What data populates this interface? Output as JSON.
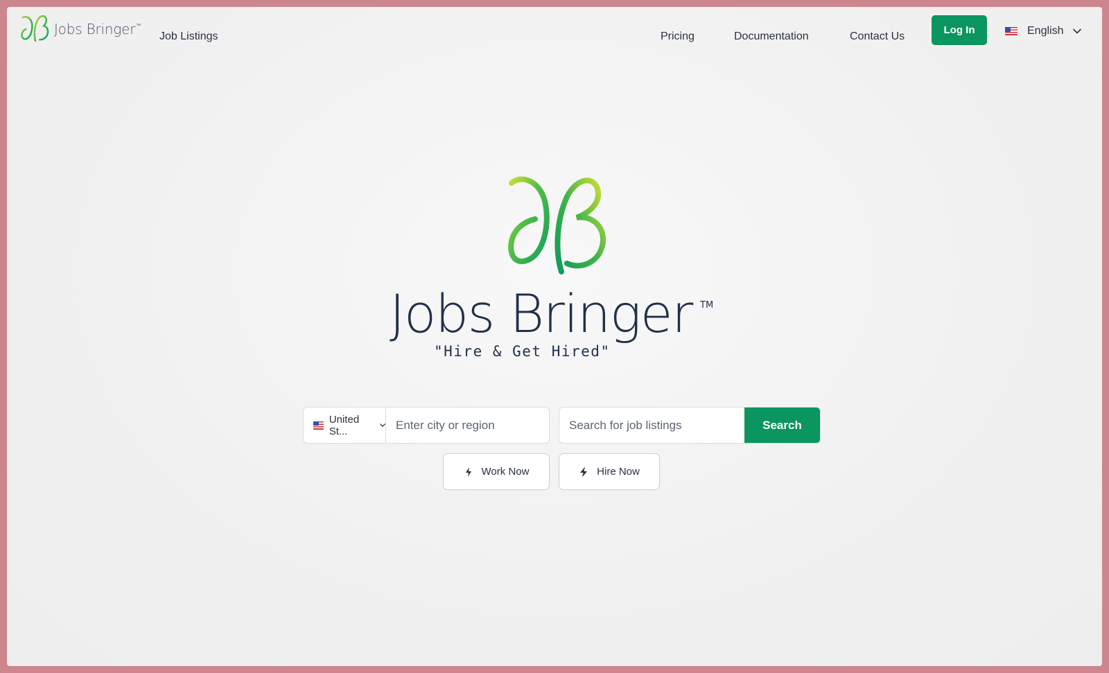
{
  "brand": {
    "name": "Jobs Bringer",
    "tm": "™"
  },
  "nav": {
    "job_listings": "Job Listings",
    "pricing": "Pricing",
    "documentation": "Documentation",
    "contact": "Contact Us",
    "login": "Log In",
    "language": "English"
  },
  "hero": {
    "title": "Jobs Bringer",
    "tm": "TM",
    "tagline": "\"Hire & Get Hired\""
  },
  "search": {
    "country": "United St...",
    "city_placeholder": "Enter city or region",
    "job_placeholder": "Search for job listings",
    "button": "Search"
  },
  "actions": {
    "work_now": "Work Now",
    "hire_now": "Hire Now"
  },
  "colors": {
    "accent": "#0b955f",
    "frame_border": "#cd858e",
    "text_dark": "#22304a"
  },
  "icons": [
    "jb-logo-icon",
    "us-flag-icon",
    "chevron-down-icon",
    "lightning-icon"
  ]
}
